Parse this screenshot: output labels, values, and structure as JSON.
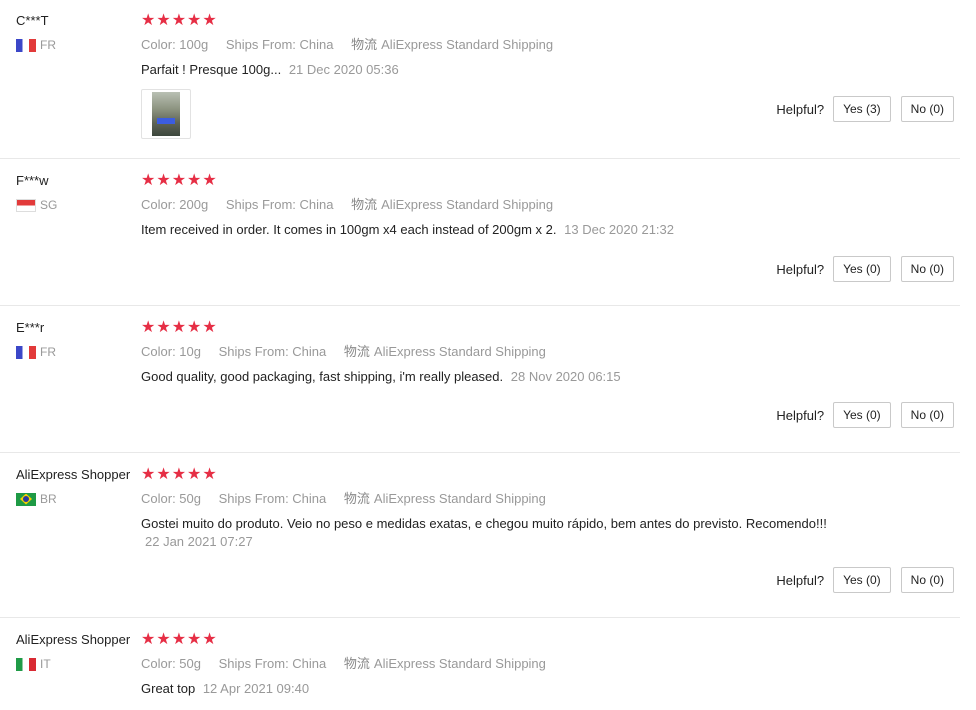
{
  "helpful_label": "Helpful?",
  "reviews": [
    {
      "user": "C***T",
      "country_code": "FR",
      "flag": "fr-flag-icon",
      "rating": 5,
      "color": "Color: 100g",
      "ships_from": "Ships From: China",
      "logistics_label": "物流",
      "logistics": "AliExpress Standard Shipping",
      "text": "Parfait ! Presque 100g...",
      "date": "21 Dec 2020 05:36",
      "has_photo": true,
      "yes": "Yes (3)",
      "no": "No (0)"
    },
    {
      "user": "F***w",
      "country_code": "SG",
      "flag": "sg-flag-icon",
      "rating": 5,
      "color": "Color: 200g",
      "ships_from": "Ships From: China",
      "logistics_label": "物流",
      "logistics": "AliExpress Standard Shipping",
      "text": "Item received in order. It comes in 100gm x4 each instead of 200gm x 2.",
      "date": "13 Dec 2020 21:32",
      "yes": "Yes (0)",
      "no": "No (0)"
    },
    {
      "user": "E***r",
      "country_code": "FR",
      "flag": "fr-flag-icon",
      "rating": 5,
      "color": "Color: 10g",
      "ships_from": "Ships From: China",
      "logistics_label": "物流",
      "logistics": "AliExpress Standard Shipping",
      "text": "Good quality, good packaging, fast shipping, i'm really pleased.",
      "date": "28 Nov 2020 06:15",
      "yes": "Yes (0)",
      "no": "No (0)"
    },
    {
      "user": "AliExpress Shopper",
      "country_code": "BR",
      "flag": "br-flag-icon",
      "rating": 5,
      "color": "Color: 50g",
      "ships_from": "Ships From: China",
      "logistics_label": "物流",
      "logistics": "AliExpress Standard Shipping",
      "text": "Gostei muito do produto. Veio no peso e medidas exatas, e chegou muito rápido, bem antes do previsto. Recomendo!!!",
      "date": "22 Jan 2021 07:27",
      "yes": "Yes (0)",
      "no": "No (0)"
    },
    {
      "user": "AliExpress Shopper",
      "country_code": "IT",
      "flag": "it-flag-icon",
      "rating": 5,
      "color": "Color: 50g",
      "ships_from": "Ships From: China",
      "logistics_label": "物流",
      "logistics": "AliExpress Standard Shipping",
      "text": "Great top",
      "date": "12 Apr 2021 09:40"
    }
  ]
}
